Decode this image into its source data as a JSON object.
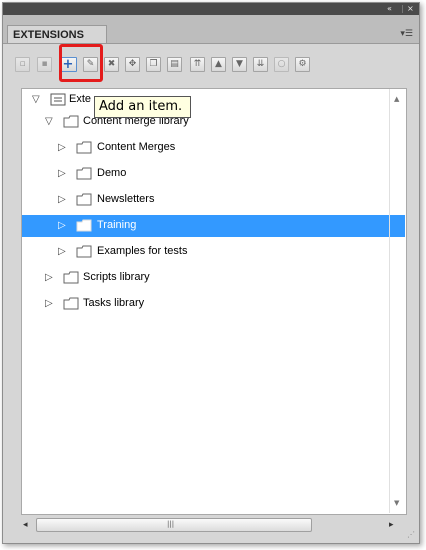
{
  "window": {
    "collapse_icon": "double-chevron-right",
    "close_icon": "close-x",
    "collapse_label": "«",
    "close_label": "×"
  },
  "panel": {
    "tab_label": "EXTENSIONS",
    "menu_icon": "panel-menu"
  },
  "toolbar": {
    "buttons": [
      {
        "name": "new-document-button",
        "icon": "new-doc",
        "enabled": false
      },
      {
        "name": "save-button",
        "icon": "save",
        "enabled": false
      },
      {
        "name": "add-item-button",
        "icon": "plus",
        "enabled": true,
        "highlighted": true
      },
      {
        "name": "edit-item-button",
        "icon": "edit",
        "enabled": true
      },
      {
        "name": "delete-item-button",
        "icon": "delete",
        "enabled": true
      },
      {
        "name": "move-button",
        "icon": "move",
        "enabled": true
      },
      {
        "name": "copy-button",
        "icon": "copy",
        "enabled": true
      },
      {
        "name": "paste-button",
        "icon": "paste",
        "enabled": true
      },
      {
        "name": "move-to-top-button",
        "icon": "double-up",
        "enabled": true
      },
      {
        "name": "move-up-button",
        "icon": "up",
        "enabled": true
      },
      {
        "name": "move-down-button",
        "icon": "down",
        "enabled": true
      },
      {
        "name": "move-to-bottom-button",
        "icon": "double-down",
        "enabled": true
      },
      {
        "name": "disabled-action-button",
        "icon": "circle",
        "enabled": false
      },
      {
        "name": "settings-button",
        "icon": "settings",
        "enabled": true
      }
    ]
  },
  "tooltip": {
    "text": "Add an item."
  },
  "tree": {
    "root_label_visible": "Exte",
    "items": [
      {
        "label": "Content merge library",
        "level": 1,
        "expanded": true,
        "selected": false
      },
      {
        "label": "Content Merges",
        "level": 2,
        "expanded": false,
        "selected": false
      },
      {
        "label": "Demo",
        "level": 2,
        "expanded": false,
        "selected": false
      },
      {
        "label": "Newsletters",
        "level": 2,
        "expanded": false,
        "selected": false
      },
      {
        "label": "Training",
        "level": 2,
        "expanded": false,
        "selected": true
      },
      {
        "label": "Examples for tests",
        "level": 2,
        "expanded": false,
        "selected": false
      },
      {
        "label": "Scripts library",
        "level": 1,
        "expanded": false,
        "selected": false
      },
      {
        "label": "Tasks library",
        "level": 1,
        "expanded": false,
        "selected": false
      }
    ]
  },
  "colors": {
    "selection": "#3399ff",
    "highlight_box": "#e41b1b",
    "tooltip_bg": "#ffffe1",
    "panel_bg": "#d6d6d6"
  }
}
